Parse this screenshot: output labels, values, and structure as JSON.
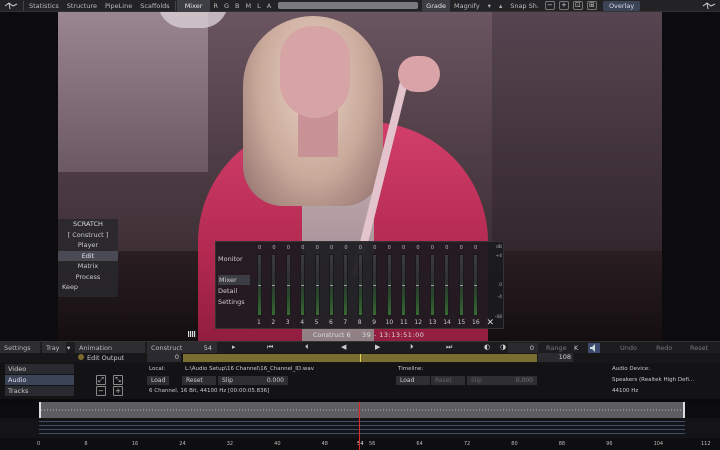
{
  "menu": {
    "items": [
      "Statistics",
      "Structure",
      "PipeLine",
      "Scaffolds"
    ],
    "mixer": "Mixer",
    "channels": [
      "R",
      "G",
      "B",
      "M",
      "L",
      "A"
    ],
    "grade": "Grade",
    "magnify": "Magnify",
    "snap": "Snap Sh.",
    "overlay": "Overlay"
  },
  "scratch_menu": {
    "title": "SCRATCH",
    "items": [
      "[ Construct ]",
      "Player",
      "Edit",
      "Matrix",
      "Process"
    ],
    "keep": "Keep"
  },
  "mixer_panel": {
    "monitor": "Monitor",
    "tabs": [
      "Mixer",
      "Detail",
      "Settings"
    ],
    "db_scale": [
      "dB",
      "+4",
      "0",
      "-4",
      "-48"
    ],
    "channel_zero": "0",
    "channels": [
      "1",
      "2",
      "3",
      "4",
      "5",
      "6",
      "7",
      "8",
      "9",
      "10",
      "11",
      "12",
      "13",
      "14",
      "15",
      "16"
    ],
    "levels": [
      0.52,
      0.52,
      0.52,
      0.52,
      0.52,
      0.52,
      0.52,
      0.52,
      0.52,
      0.52,
      0.52,
      0.52,
      0.52,
      0.52,
      0.52,
      0.52
    ]
  },
  "timecode": {
    "label": "Construct 6",
    "value": "39 - 13:13:51:00"
  },
  "transport": {
    "settings": "Settings",
    "tray": "Tray",
    "animation": "Animation",
    "construct": "Construct",
    "frame": "54",
    "in_value": "0",
    "range": "Range",
    "k": "K",
    "undo": "Undo",
    "redo": "Redo",
    "reset": "Reset"
  },
  "edit_output": {
    "label": "Edit Output",
    "start": "0",
    "end": "108",
    "cursor": 0.5
  },
  "panel": {
    "tabs": [
      "Video",
      "Audio",
      "Tracks"
    ],
    "local_label": "Local:",
    "local_path": "L:\\Audio Setup\\16 Channel\\16_Channel_ID.wav",
    "local_info": "6 Channel, 16 Bit, 44100 Hz [00:00:05.836]",
    "load": "Load",
    "reset": "Reset",
    "slip": "Slip",
    "slip_value": "0.000",
    "timeline_label": "Timeline:",
    "tl_load": "Load",
    "tl_reset": "Reset",
    "tl_slip": "Slip",
    "tl_slip_value": "0.000",
    "device_label": "Audio Device:",
    "device_name": "Speakers (Realtek High Defi...",
    "device_rate": "44100 Hz"
  },
  "ruler": {
    "ticks": [
      "0",
      "8",
      "16",
      "24",
      "32",
      "40",
      "48",
      "54",
      "56",
      "64",
      "72",
      "80",
      "88",
      "96",
      "104",
      "112"
    ],
    "current": "54"
  },
  "colors": {
    "accent": "#3c4458",
    "playhead": "#e02a2a",
    "output_bar": "#7a6d30",
    "jacket": "#d23f6a"
  }
}
